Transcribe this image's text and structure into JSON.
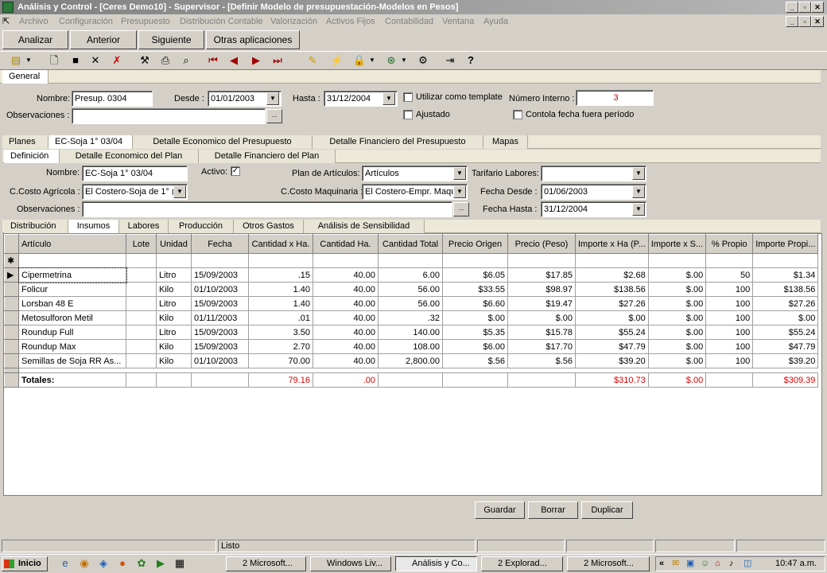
{
  "window": {
    "title": "Análisis y Control - [Ceres Demo10] - Supervisor - [Definir Modelo de presupuestación-Modelos en Pesos]"
  },
  "menu": [
    "Archivo",
    "Configuración",
    "Presupuesto",
    "Distribución Contable",
    "Valorización",
    "Activos Fijos",
    "Contabilidad",
    "Ventana",
    "Ayuda"
  ],
  "commands": {
    "analizar": "Analizar",
    "anterior": "Anterior",
    "siguiente": "Siguiente",
    "otras": "Otras aplicaciones"
  },
  "tab_general": "General",
  "header": {
    "nombre_label": "Nombre:",
    "nombre": "Presup. 0304",
    "desde_label": "Desde :",
    "desde": "01/01/2003",
    "hasta_label": "Hasta :",
    "hasta": "31/12/2004",
    "template_label": "Utilizar como template",
    "ajustado_label": "Ajustado",
    "numero_label": "Número Interno :",
    "numero": "3",
    "controla_label": "Contola fecha fuera período",
    "obs_label": "Observaciones :",
    "obs": "",
    "dots": "..."
  },
  "tabs_main": [
    "Planes",
    "EC-Soja 1° 03/04",
    "Detalle Economico del Presupuesto",
    "Detalle Financiero del Presupuesto",
    "Mapas"
  ],
  "tabs_plan": [
    "Definición",
    "Detalle Economico del Plan",
    "Detalle Financiero del Plan"
  ],
  "plan": {
    "nombre_label": "Nombre:",
    "nombre": "EC-Soja 1° 03/04",
    "activo_label": "Activo:",
    "activo_check": "✓",
    "plan_art_label": "Plan de Artículos:",
    "plan_art": "Artículos",
    "tarifario_label": "Tarifario Labores:",
    "tarifario": "",
    "ccagr_label": "C.Costo Agrícola :",
    "ccagr": "El Costero-Soja de 1° (",
    "ccmaq_label": "C.Costo Maquinaria :",
    "ccmaq": "El Costero-Empr. Maqu",
    "fdesde_label": "Fecha Desde :",
    "fdesde": "01/06/2003",
    "obs_label": "Observaciones :",
    "obs": "",
    "fhasta_label": "Fecha Hasta :",
    "fhasta": "31/12/2004"
  },
  "tabs_sub": [
    "Distribución",
    "Insumos",
    "Labores",
    "Producción",
    "Otros Gastos",
    "Análisis de Sensibilidad"
  ],
  "grid": {
    "columns": [
      "Artículo",
      "Lote",
      "Unidad",
      "Fecha",
      "Cantidad x Ha.",
      "Cantidad Ha.",
      "Cantidad Total",
      "Precio Origen",
      "Precio (Peso)",
      "Importe x Ha (P...",
      "Importe x S...",
      "% Propio",
      "Importe Propi..."
    ],
    "new_row_marker": "✱",
    "current_row_marker": "▶",
    "rows": [
      [
        "Cipermetrina",
        "",
        "Litro",
        "15/09/2003",
        ".15",
        "40.00",
        "6.00",
        "$6.05",
        "$17.85",
        "$2.68",
        "$.00",
        "50",
        "$1.34"
      ],
      [
        "Folicur",
        "",
        "Kilo",
        "01/10/2003",
        "1.40",
        "40.00",
        "56.00",
        "$33.55",
        "$98.97",
        "$138.56",
        "$.00",
        "100",
        "$138.56"
      ],
      [
        "Lorsban 48 E",
        "",
        "Litro",
        "15/09/2003",
        "1.40",
        "40.00",
        "56.00",
        "$6.60",
        "$19.47",
        "$27.26",
        "$.00",
        "100",
        "$27.26"
      ],
      [
        "Metosulforon Metil",
        "",
        "Kilo",
        "01/11/2003",
        ".01",
        "40.00",
        ".32",
        "$.00",
        "$.00",
        "$.00",
        "$.00",
        "100",
        "$.00"
      ],
      [
        "Roundup Full",
        "",
        "Litro",
        "15/09/2003",
        "3.50",
        "40.00",
        "140.00",
        "$5.35",
        "$15.78",
        "$55.24",
        "$.00",
        "100",
        "$55.24"
      ],
      [
        "Roundup Max",
        "",
        "Kilo",
        "15/09/2003",
        "2.70",
        "40.00",
        "108.00",
        "$6.00",
        "$17.70",
        "$47.79",
        "$.00",
        "100",
        "$47.79"
      ],
      [
        "Semillas de Soja RR As...",
        "",
        "Kilo",
        "01/10/2003",
        "70.00",
        "40.00",
        "2,800.00",
        "$.56",
        "$.56",
        "$39.20",
        "$.00",
        "100",
        "$39.20"
      ]
    ],
    "totals": {
      "label": "Totales:",
      "cant_x_ha": "79.16",
      "cant_ha": ".00",
      "imp_x_ha": "$310.73",
      "imp_x_s": "$.00",
      "imp_propio": "$309.39"
    }
  },
  "buttons": {
    "guardar": "Guardar",
    "borrar": "Borrar",
    "duplicar": "Duplicar"
  },
  "status": {
    "text": "Listo"
  },
  "taskbar": {
    "start": "Inicio",
    "items": [
      "2 Microsoft...",
      "Windows Liv...",
      "Análisis y Co...",
      "2 Explorad...",
      "2 Microsoft..."
    ],
    "clock": "10:47 a.m."
  }
}
